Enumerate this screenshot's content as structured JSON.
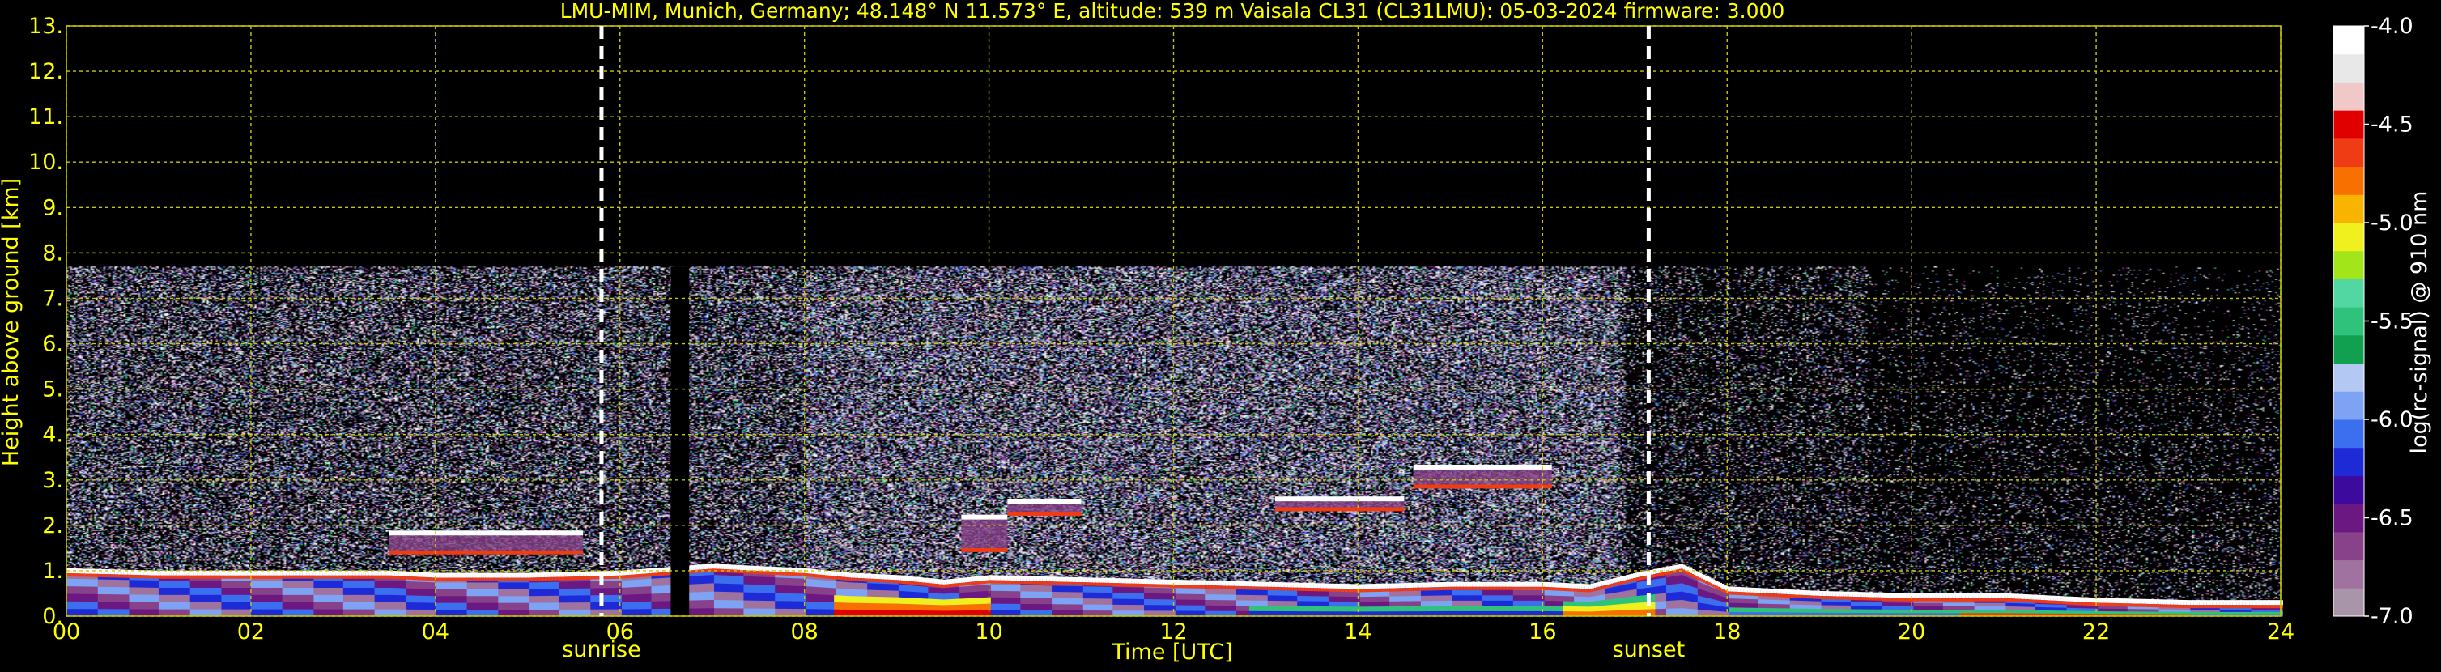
{
  "chart_data": {
    "type": "heatmap",
    "title": "LMU-MIM, Munich, Germany; 48.148° N 11.573° E, altitude: 539 m    Vaisala CL31 (CL31LMU): 05-03-2024    firmware: 3.000",
    "xlabel": "Time [UTC]",
    "ylabel": "Height above ground [km]",
    "x_ticks": [
      "00",
      "02",
      "04",
      "06",
      "08",
      "10",
      "12",
      "14",
      "16",
      "18",
      "20",
      "22",
      "24"
    ],
    "x_tick_values": [
      0,
      2,
      4,
      6,
      8,
      10,
      12,
      14,
      16,
      18,
      20,
      22,
      24
    ],
    "y_ticks": [
      "0.",
      "1.",
      "2.",
      "3.",
      "4.",
      "5.",
      "6.",
      "7.",
      "8.",
      "9.",
      "10.",
      "11.",
      "12.",
      "13."
    ],
    "y_tick_values": [
      0,
      1,
      2,
      3,
      4,
      5,
      6,
      7,
      8,
      9,
      10,
      11,
      12,
      13
    ],
    "xlim": [
      0,
      24
    ],
    "ylim": [
      0,
      13
    ],
    "grid": true,
    "data_top_km": 7.7,
    "data_gap_hours": [
      6.55,
      6.75
    ],
    "events": [
      {
        "label": "sunrise",
        "time": 5.8
      },
      {
        "label": "sunset",
        "time": 17.15
      }
    ],
    "boundary_layer_top_km": [
      [
        0,
        1.0
      ],
      [
        1,
        0.95
      ],
      [
        2,
        0.95
      ],
      [
        3,
        0.95
      ],
      [
        3.5,
        0.95
      ],
      [
        4,
        0.9
      ],
      [
        5,
        0.9
      ],
      [
        6,
        0.95
      ],
      [
        7,
        1.1
      ],
      [
        8,
        1.0
      ],
      [
        8.5,
        0.9
      ],
      [
        9,
        0.85
      ],
      [
        9.5,
        0.75
      ],
      [
        10,
        0.85
      ],
      [
        11,
        0.8
      ],
      [
        12,
        0.75
      ],
      [
        13,
        0.7
      ],
      [
        14,
        0.65
      ],
      [
        15,
        0.7
      ],
      [
        16,
        0.7
      ],
      [
        16.5,
        0.65
      ],
      [
        17,
        0.9
      ],
      [
        17.5,
        1.1
      ],
      [
        18,
        0.6
      ],
      [
        19,
        0.5
      ],
      [
        20,
        0.45
      ],
      [
        21,
        0.45
      ],
      [
        22,
        0.35
      ],
      [
        23,
        0.3
      ],
      [
        24,
        0.3
      ]
    ],
    "cloud_layers": [
      {
        "start": 3.5,
        "end": 5.6,
        "base_km": 1.45,
        "top_km": 1.85
      },
      {
        "start": 9.7,
        "end": 10.2,
        "base_km": 1.5,
        "top_km": 2.2
      },
      {
        "start": 10.2,
        "end": 11.0,
        "base_km": 2.3,
        "top_km": 2.55
      },
      {
        "start": 13.1,
        "end": 14.5,
        "base_km": 2.4,
        "top_km": 2.6
      },
      {
        "start": 14.6,
        "end": 16.1,
        "base_km": 2.9,
        "top_km": 3.3
      }
    ],
    "colorbar": {
      "label": "log(rc-signal) @ 910 nm",
      "ticks": [
        "-4.0",
        "-4.5",
        "-5.0",
        "-5.5",
        "-6.0",
        "-6.5",
        "-7.0"
      ],
      "tick_values": [
        -4.0,
        -4.5,
        -5.0,
        -5.5,
        -6.0,
        -6.5,
        -7.0
      ],
      "range": [
        -7.0,
        -4.0
      ],
      "colors": [
        "#a995aa",
        "#a0729f",
        "#88428a",
        "#6c1882",
        "#3c0a9c",
        "#1e2ad6",
        "#3c6ef0",
        "#7ea3f4",
        "#b4c8f4",
        "#10a050",
        "#2ec27a",
        "#52d6a2",
        "#a2e61a",
        "#f0f01e",
        "#f8b400",
        "#f87000",
        "#f03c14",
        "#e00000",
        "#f0c8c8",
        "#e8e8e8",
        "#ffffff"
      ]
    }
  },
  "colors": {
    "background": "#000000",
    "text": "#ffff00",
    "grid": "#c8c800",
    "colorbar_text": "#ffffff",
    "event_line": "#ffffff"
  }
}
